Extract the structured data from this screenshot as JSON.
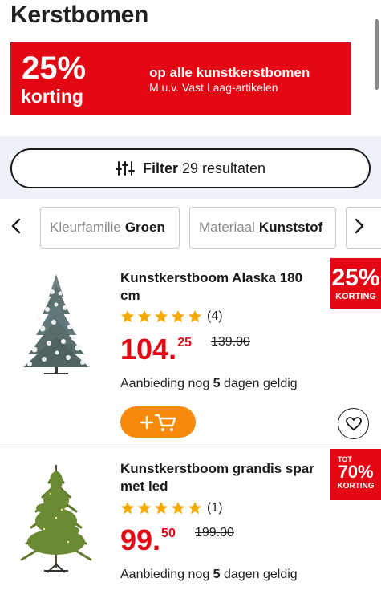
{
  "page": {
    "title": "Kerstbomen"
  },
  "promo": {
    "percent": "25%",
    "off_label": "korting",
    "title": "op alle kunstkerstbomen",
    "subtitle": "M.u.v. Vast Laag-artikelen",
    "color": "#e30613"
  },
  "filter": {
    "label": "Filter",
    "results": "29 resultaten",
    "icon": "sliders-icon"
  },
  "chips": [
    {
      "key": "Kleurfamilie",
      "value": "Groen"
    },
    {
      "key": "Materiaal",
      "value": "Kunststof"
    }
  ],
  "products": [
    {
      "name": "Kunstkerstboom Alaska 180 cm",
      "rating": 5,
      "reviews": "(4)",
      "price_int": "104.",
      "price_dec": "25",
      "old_price": "139.00",
      "deal_prefix": "Aanbieding nog",
      "deal_days": "5",
      "deal_suffix": "dagen geldig",
      "badge": {
        "top": "",
        "big": "25%",
        "small": "KORTING"
      }
    },
    {
      "name": "Kunstkerstboom grandis spar met led",
      "rating": 5,
      "reviews": "(1)",
      "price_int": "99.",
      "price_dec": "50",
      "old_price": "199.00",
      "deal_prefix": "Aanbieding nog",
      "deal_days": "5",
      "deal_suffix": "dagen geldig",
      "badge": {
        "top": "TOT",
        "big": "70%",
        "small": "KORTING"
      }
    }
  ],
  "colors": {
    "accent": "#e30613",
    "cart": "#f78a0c",
    "star": "#f5a800",
    "filter_band": "#eef2f8"
  }
}
